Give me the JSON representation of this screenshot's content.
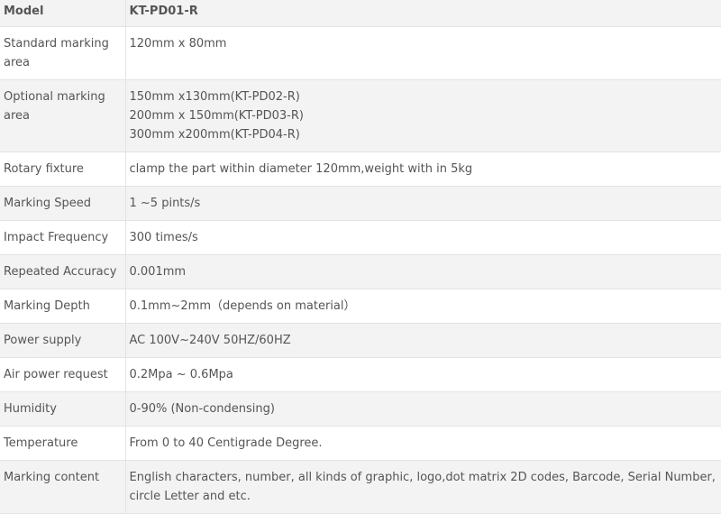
{
  "header": {
    "label": "Model",
    "value": "KT-PD01-R"
  },
  "rows": [
    {
      "label": "Standard marking area",
      "value": [
        "120mm x 80mm"
      ]
    },
    {
      "label": "Optional marking area",
      "value": [
        "150mm x130mm(KT-PD02-R)",
        "200mm x 150mm(KT-PD03-R)",
        "300mm x200mm(KT-PD04-R)"
      ]
    },
    {
      "label": "Rotary fixture",
      "value": [
        "clamp the part within diameter 120mm,weight with in 5kg"
      ]
    },
    {
      "label": "Marking Speed",
      "value": [
        "1 ~5 pints/s"
      ]
    },
    {
      "label": "Impact Frequency",
      "value": [
        "300 times/s"
      ]
    },
    {
      "label": "Repeated Accuracy",
      "value": [
        "0.001mm"
      ]
    },
    {
      "label": "Marking Depth",
      "value": [
        "0.1mm~2mm（depends on material）"
      ]
    },
    {
      "label": "Power supply",
      "value": [
        "AC 100V~240V 50HZ/60HZ"
      ]
    },
    {
      "label": "Air power request",
      "value": [
        "0.2Mpa ~ 0.6Mpa"
      ]
    },
    {
      "label": "Humidity",
      "value": [
        "0-90% (Non-condensing)"
      ]
    },
    {
      "label": "Temperature",
      "value": [
        "From 0 to 40 Centigrade Degree."
      ]
    },
    {
      "label": "Marking content",
      "value": [
        "English characters, number, all kinds of graphic, logo,dot matrix 2D codes, Barcode, Serial Number, circle Letter and etc."
      ]
    }
  ]
}
